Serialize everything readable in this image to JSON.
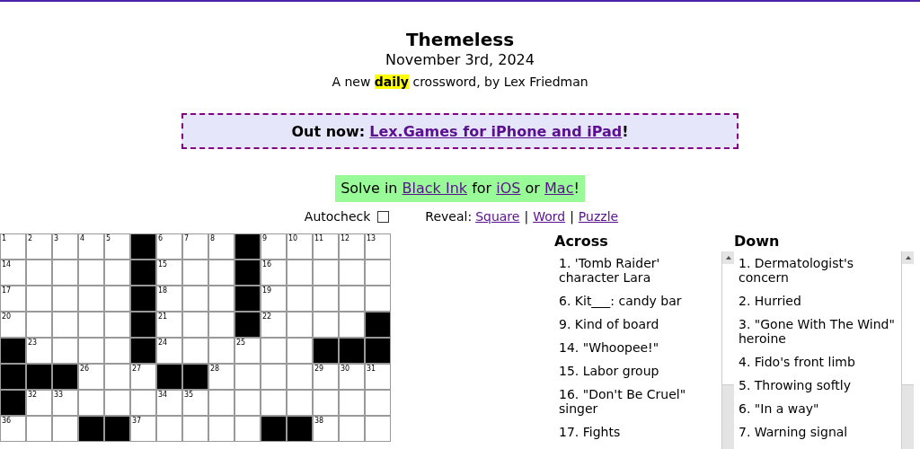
{
  "header": {
    "title": "Themeless",
    "date": "November 3rd, 2024",
    "tagline": "A new **daily** crossword, by Lex Friedman"
  },
  "banner": {
    "lead": "Out now:",
    "link": "Lex.Games for iPhone and iPad",
    "tail": "!"
  },
  "promo": {
    "parts": [
      {
        "kind": "text",
        "text": "Solve in"
      },
      {
        "kind": "link",
        "text": "Black Ink"
      },
      {
        "kind": "text",
        "text": "for"
      },
      {
        "kind": "link",
        "text": "iOS"
      },
      {
        "kind": "text",
        "text": "or"
      },
      {
        "kind": "link",
        "text": "Mac"
      },
      {
        "kind": "text",
        "text": "!"
      }
    ]
  },
  "controls": {
    "autocheck": {
      "label": "Autocheck",
      "checked": false
    },
    "reveal_label": "Reveal:",
    "reveal_links": [
      "Square",
      "Word",
      "Puzzle"
    ],
    "separators": [
      "|",
      "|"
    ]
  },
  "grid": {
    "rows": [
      [
        {
          "black": false,
          "number": "1"
        },
        {
          "black": false,
          "number": "2"
        },
        {
          "black": false,
          "number": "3"
        },
        {
          "black": false,
          "number": "4"
        },
        {
          "black": false,
          "number": "5"
        },
        {
          "black": true
        },
        {
          "black": false,
          "number": "6"
        },
        {
          "black": false,
          "number": "7"
        },
        {
          "black": false,
          "number": "8"
        },
        {
          "black": true
        },
        {
          "black": false,
          "number": "9"
        },
        {
          "black": false,
          "number": "10"
        },
        {
          "black": false,
          "number": "11"
        },
        {
          "black": false,
          "number": "12"
        },
        {
          "black": false,
          "number": "13"
        }
      ],
      [
        {
          "black": false,
          "number": "14"
        },
        {
          "black": false
        },
        {
          "black": false
        },
        {
          "black": false
        },
        {
          "black": false
        },
        {
          "black": true
        },
        {
          "black": false,
          "number": "15"
        },
        {
          "black": false
        },
        {
          "black": false
        },
        {
          "black": true
        },
        {
          "black": false,
          "number": "16"
        },
        {
          "black": false
        },
        {
          "black": false
        },
        {
          "black": false
        },
        {
          "black": false
        }
      ],
      [
        {
          "black": false,
          "number": "17"
        },
        {
          "black": false
        },
        {
          "black": false
        },
        {
          "black": false
        },
        {
          "black": false
        },
        {
          "black": true
        },
        {
          "black": false,
          "number": "18"
        },
        {
          "black": false
        },
        {
          "black": false
        },
        {
          "black": true
        },
        {
          "black": false,
          "number": "19"
        },
        {
          "black": false
        },
        {
          "black": false
        },
        {
          "black": false
        },
        {
          "black": false
        }
      ],
      [
        {
          "black": false,
          "number": "20"
        },
        {
          "black": false
        },
        {
          "black": false
        },
        {
          "black": false
        },
        {
          "black": false
        },
        {
          "black": true
        },
        {
          "black": false,
          "number": "21"
        },
        {
          "black": false
        },
        {
          "black": false
        },
        {
          "black": true
        },
        {
          "black": false,
          "number": "22"
        },
        {
          "black": false
        },
        {
          "black": false
        },
        {
          "black": false
        },
        {
          "black": true
        }
      ],
      [
        {
          "black": true
        },
        {
          "black": false,
          "number": "23"
        },
        {
          "black": false
        },
        {
          "black": false
        },
        {
          "black": false
        },
        {
          "black": true
        },
        {
          "black": false,
          "number": "24"
        },
        {
          "black": false
        },
        {
          "black": false
        },
        {
          "black": false,
          "number": "25"
        },
        {
          "black": false
        },
        {
          "black": false
        },
        {
          "black": true
        },
        {
          "black": true
        },
        {
          "black": true
        }
      ],
      [
        {
          "black": true
        },
        {
          "black": true
        },
        {
          "black": true
        },
        {
          "black": false,
          "number": "26"
        },
        {
          "black": false
        },
        {
          "black": false,
          "number": "27"
        },
        {
          "black": true
        },
        {
          "black": true
        },
        {
          "black": false,
          "number": "28"
        },
        {
          "black": false
        },
        {
          "black": false
        },
        {
          "black": false
        },
        {
          "black": false,
          "number": "29"
        },
        {
          "black": false,
          "number": "30"
        },
        {
          "black": false,
          "number": "31"
        }
      ],
      [
        {
          "black": true
        },
        {
          "black": false,
          "number": "32"
        },
        {
          "black": false,
          "number": "33"
        },
        {
          "black": false
        },
        {
          "black": false
        },
        {
          "black": false
        },
        {
          "black": false,
          "number": "34"
        },
        {
          "black": false,
          "number": "35"
        },
        {
          "black": false
        },
        {
          "black": false
        },
        {
          "black": false
        },
        {
          "black": false
        },
        {
          "black": false
        },
        {
          "black": false
        },
        {
          "black": false
        }
      ],
      [
        {
          "black": false,
          "number": "36"
        },
        {
          "black": false
        },
        {
          "black": false
        },
        {
          "black": true
        },
        {
          "black": true
        },
        {
          "black": false,
          "number": "37"
        },
        {
          "black": false
        },
        {
          "black": false
        },
        {
          "black": false
        },
        {
          "black": false
        },
        {
          "black": true
        },
        {
          "black": true
        },
        {
          "black": false,
          "number": "38"
        },
        {
          "black": false
        },
        {
          "black": false
        }
      ]
    ]
  },
  "clues": [
    {
      "heading": "Across",
      "items": [
        "1. 'Tomb Raider' character Lara",
        "6. Kit___: candy bar",
        "9. Kind of board",
        "14. \"Whoopee!\"",
        "15. Labor group",
        "16. \"Don't Be Cruel\" singer",
        "17. Fights"
      ]
    },
    {
      "heading": "Down",
      "items": [
        "1. Dermatologist's concern",
        "2. Hurried",
        "3. \"Gone With The Wind\" heroine",
        "4. Fido's front limb",
        "5. Throwing softly",
        "6. \"In a way\"",
        "7. Warning signal"
      ]
    }
  ]
}
